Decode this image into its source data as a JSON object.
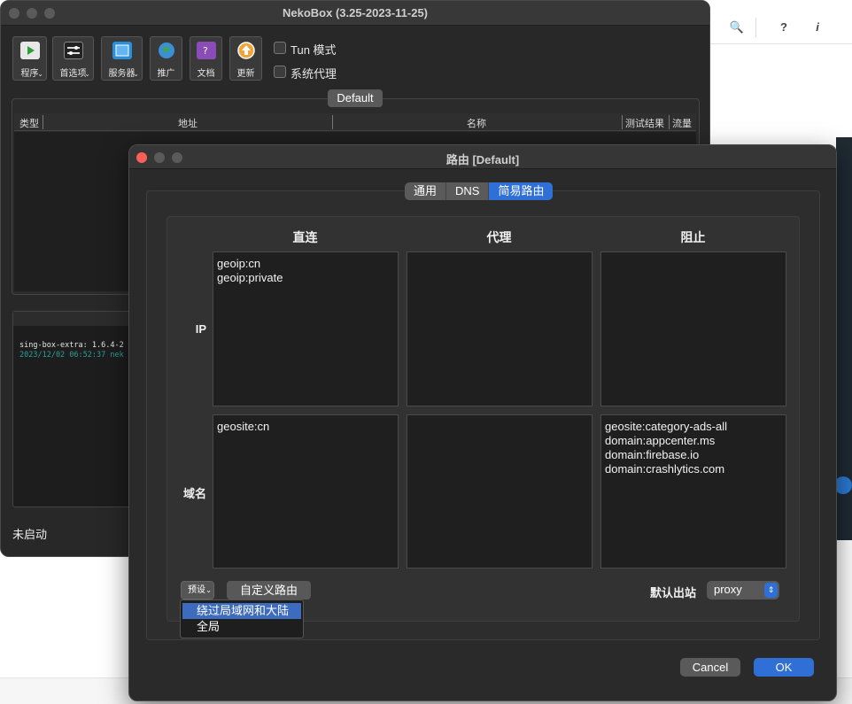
{
  "background": {
    "search_icon": "🔍",
    "help_icon": "?",
    "info_icon": "i"
  },
  "main_window": {
    "title": "NekoBox (3.25-2023-11-25)",
    "toolbar": [
      {
        "label": "程序",
        "icon": "play-icon"
      },
      {
        "label": "首选项",
        "icon": "preferences-icon"
      },
      {
        "label": "服务器",
        "icon": "server-icon"
      },
      {
        "label": "推广",
        "icon": "globe-icon"
      },
      {
        "label": "文档",
        "icon": "docs-icon"
      },
      {
        "label": "更新",
        "icon": "update-icon"
      }
    ],
    "checkboxes": {
      "tun_mode": "Tun 模式",
      "system_proxy": "系统代理"
    },
    "group_tab": "Default",
    "table_headers": [
      "类型",
      "地址",
      "名称",
      "测试结果",
      "流量"
    ],
    "log_lines": [
      "sing-box-extra: 1.6.4-2",
      "2023/12/02 06:52:37 nek"
    ],
    "status": "未启动"
  },
  "dialog": {
    "title": "路由 [Default]",
    "tabs": [
      "通用",
      "DNS",
      "简易路由"
    ],
    "active_tab": "简易路由",
    "columns": [
      "直连",
      "代理",
      "阻止"
    ],
    "rows": [
      "IP",
      "域名"
    ],
    "ip": {
      "direct": [
        "geoip:cn",
        "geoip:private"
      ],
      "proxy": [],
      "block": []
    },
    "domain": {
      "direct": [
        "geosite:cn"
      ],
      "proxy": [],
      "block": [
        "geosite:category-ads-all",
        "domain:appcenter.ms",
        "domain:firebase.io",
        "domain:crashlytics.com"
      ]
    },
    "preset_button": "预设",
    "custom_route_button": "自定义路由",
    "preset_menu": [
      "绕过局域网和大陆",
      "全局"
    ],
    "default_outbound_label": "默认出站",
    "default_outbound_value": "proxy",
    "cancel": "Cancel",
    "ok": "OK"
  },
  "colors": {
    "accent": "#2f6fd6",
    "menu_highlight": "#3d6bbd",
    "log_timestamp": "#2aa198"
  }
}
